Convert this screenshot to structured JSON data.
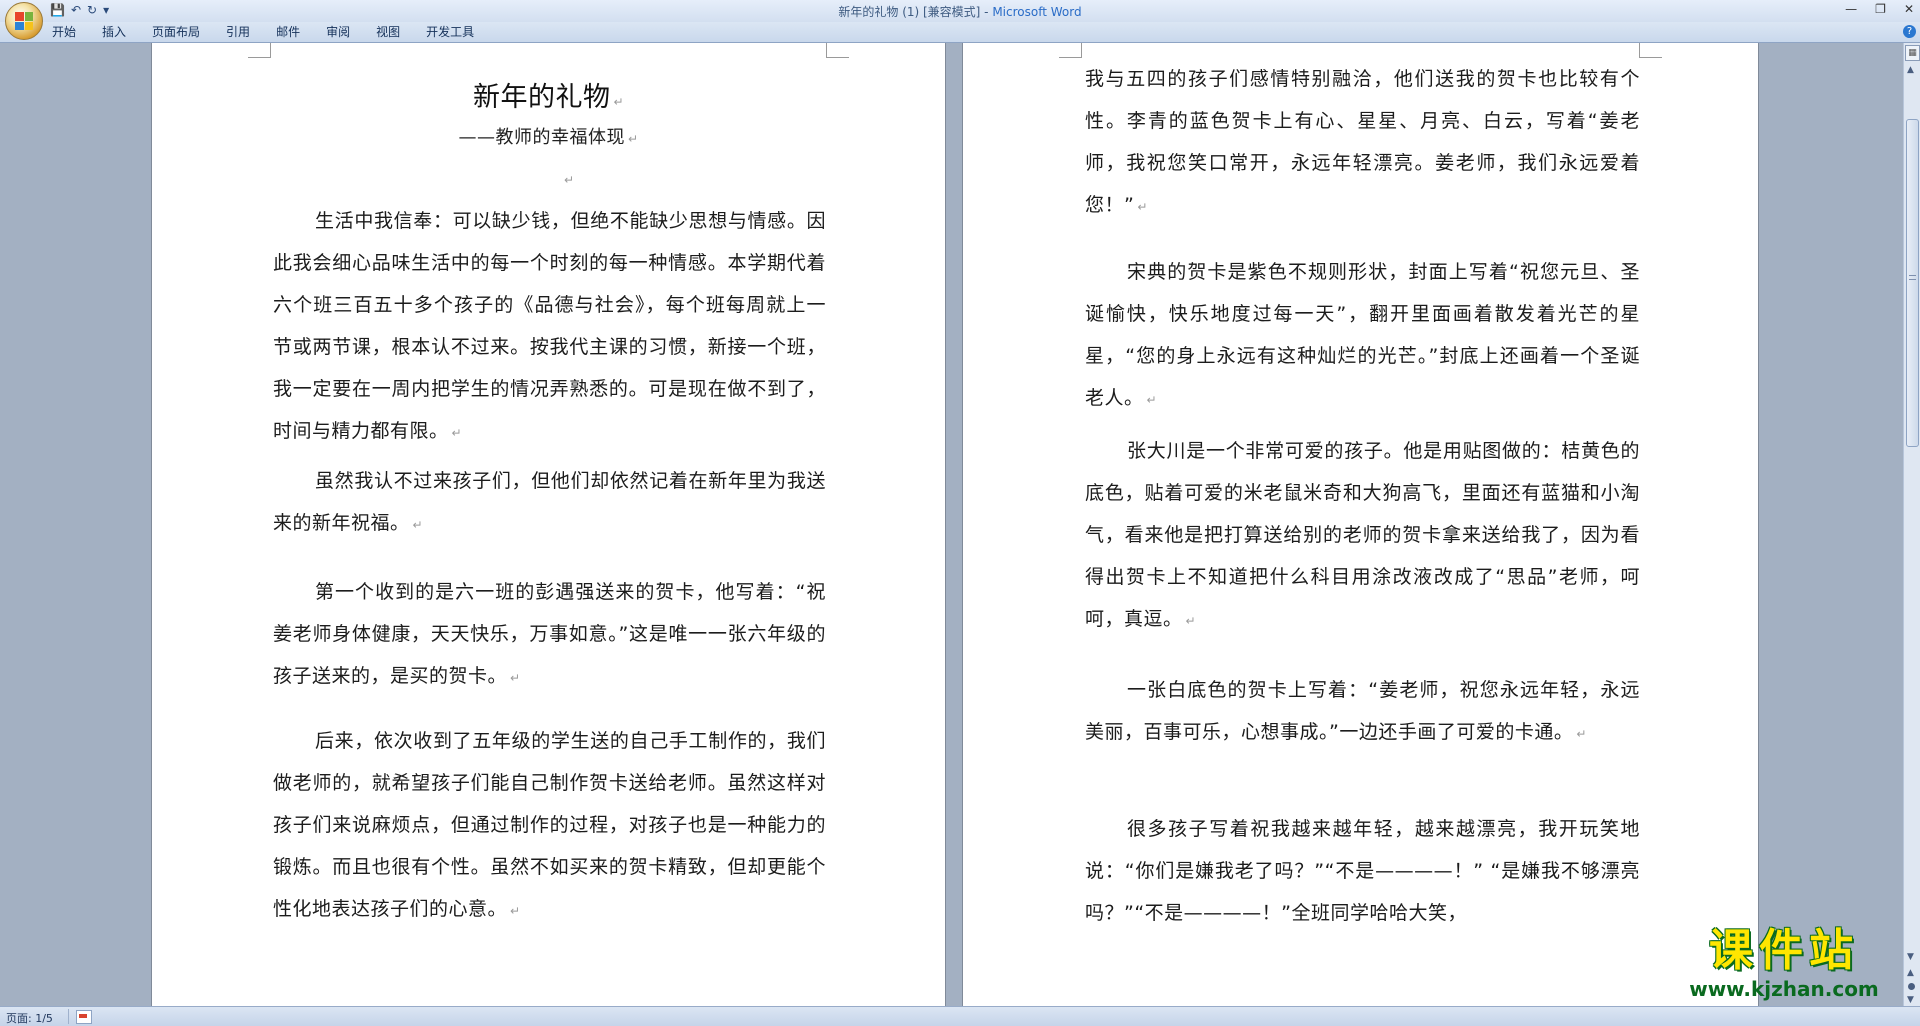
{
  "window": {
    "title_doc": "新年的礼物 (1) [兼容模式] - ",
    "title_app": "Microsoft Word"
  },
  "quick_access": {
    "save_icon": "save-icon",
    "undo_icon": "undo-icon",
    "redo_icon": "redo-icon",
    "customize_icon": "dropdown-icon"
  },
  "ribbon": {
    "tabs": [
      "开始",
      "插入",
      "页面布局",
      "引用",
      "邮件",
      "审阅",
      "视图",
      "开发工具"
    ]
  },
  "document": {
    "title": "新年的礼物",
    "subtitle": "——教师的幸福体现",
    "left_paragraphs": [
      "生活中我信奉：可以缺少钱，但绝不能缺少思想与情感。因此我会细心品味生活中的每一个时刻的每一种情感。本学期代着六个班三百五十多个孩子的《品德与社会》，每个班每周就上一节或两节课，根本认不过来。按我代主课的习惯，新接一个班，我一定要在一周内把学生的情况弄熟悉的。可是现在做不到了，时间与精力都有限。",
      "虽然我认不过来孩子们，但他们却依然记着在新年里为我送来的新年祝福。",
      "第一个收到的是六一班的彭遇强送来的贺卡，他写着：“祝姜老师身体健康，天天快乐，万事如意。”这是唯一一张六年级的孩子送来的，是买的贺卡。",
      "后来，依次收到了五年级的学生送的自己手工制作的，我们做老师的，就希望孩子们能自己制作贺卡送给老师。虽然这样对孩子们来说麻烦点，但通过制作的过程，对孩子也是一种能力的锻炼。而且也很有个性。虽然不如买来的贺卡精致，但却更能个性化地表达孩子们的心意。"
    ],
    "right_paragraphs": [
      "我与五四的孩子们感情特别融洽，他们送我的贺卡也比较有个性。李青的蓝色贺卡上有心、星星、月亮、白云，写着“姜老师，我祝您笑口常开，永远年轻漂亮。姜老师，我们永远爱着您！”",
      "宋典的贺卡是紫色不规则形状，封面上写着“祝您元旦、圣诞愉快，快乐地度过每一天”，翻开里面画着散发着光芒的星星，“您的身上永远有这种灿烂的光芒。”封底上还画着一个圣诞老人。",
      "张大川是一个非常可爱的孩子。他是用贴图做的：桔黄色的底色，贴着可爱的米老鼠米奇和大狗高飞，里面还有蓝猫和小淘气，看来他是把打算送给别的老师的贺卡拿来送给我了，因为看得出贺卡上不知道把什么科目用涂改液改成了“思品”老师，呵呵，真逗。",
      "一张白底色的贺卡上写着：“姜老师，祝您永远年轻，永远美丽，百事可乐，心想事成。”一边还手画了可爱的卡通。",
      "很多孩子写着祝我越来越年轻，越来越漂亮，我开玩笑地说：“你们是嫌我老了吗？”“不是————！” “是嫌我不够漂亮吗？”“不是————！”全班同学哈哈大笑，"
    ],
    "paragraph_mark": "↵"
  },
  "status_bar": {
    "page_indicator": "页面: 1/5"
  },
  "watermark": {
    "main": "课件站",
    "url": "www.kjzhan.com"
  },
  "colors": {
    "app_title_blue": "#2a6cc7",
    "watermark_yellow": "#ffe600",
    "watermark_green": "#0a6a1f"
  }
}
